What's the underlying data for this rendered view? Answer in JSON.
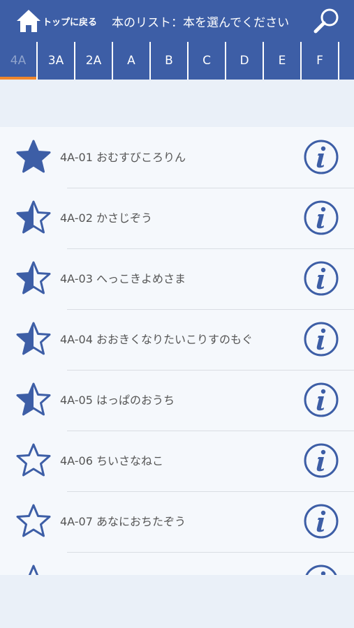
{
  "header": {
    "home_label": "トップに戻る",
    "title": "本のリスト：本を選んでください"
  },
  "tabs": [
    {
      "label": "4A",
      "active": true
    },
    {
      "label": "3A"
    },
    {
      "label": "2A"
    },
    {
      "label": "A"
    },
    {
      "label": "B"
    },
    {
      "label": "C"
    },
    {
      "label": "D"
    },
    {
      "label": "E"
    },
    {
      "label": "F"
    }
  ],
  "books": [
    {
      "title": "4A-01 おむすびころりん",
      "star": "full"
    },
    {
      "title": "4A-02 かさじぞう",
      "star": "half"
    },
    {
      "title": "4A-03 へっこきよめさま",
      "star": "half"
    },
    {
      "title": "4A-04 おおきくなりたいこりすのもぐ",
      "star": "half"
    },
    {
      "title": "4A-05 はっぱのおうち",
      "star": "half"
    },
    {
      "title": "4A-06 ちいさなねこ",
      "star": "empty"
    },
    {
      "title": "4A-07 あなにおちたぞう",
      "star": "empty"
    },
    {
      "title": "",
      "star": "empty"
    }
  ],
  "colors": {
    "brand": "#3d5ea6",
    "accent_active_tab": "#f0862c",
    "star_blue": "#3d5ea6"
  },
  "icons": {
    "home": "home-icon",
    "search": "search-icon",
    "star_full": "star-full-icon",
    "star_half": "star-half-icon",
    "star_empty": "star-empty-icon",
    "info": "info-icon"
  }
}
